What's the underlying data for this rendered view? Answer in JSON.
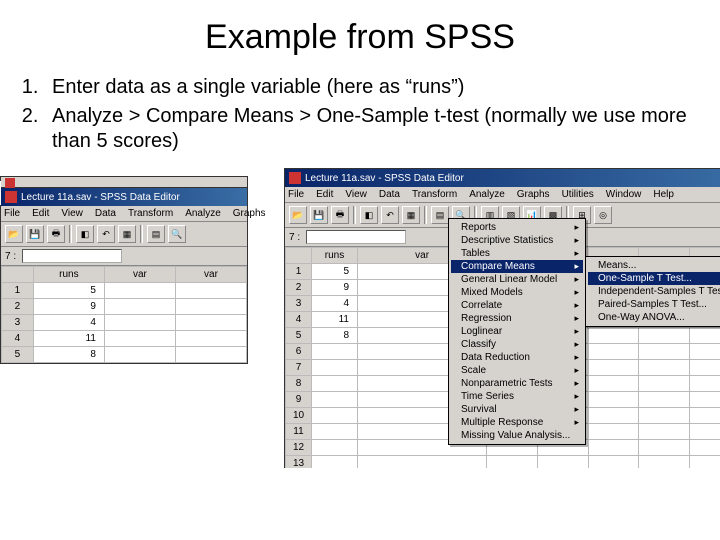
{
  "slide": {
    "title": "Example from SPSS",
    "items": [
      "Enter data as a single variable (here as “runs”)",
      "Analyze > Compare Means > One-Sample t-test (normally we use more than 5 scores)"
    ]
  },
  "left_window": {
    "title": "Lecture 11a.sav - SPSS Data Editor",
    "menus": [
      "File",
      "Edit",
      "View",
      "Data",
      "Transform",
      "Analyze",
      "Graphs"
    ],
    "cell_ref": "7 :",
    "columns": [
      "runs",
      "var",
      "var"
    ],
    "rows": [
      {
        "n": "1",
        "runs": "5"
      },
      {
        "n": "2",
        "runs": "9"
      },
      {
        "n": "3",
        "runs": "4"
      },
      {
        "n": "4",
        "runs": "11"
      },
      {
        "n": "5",
        "runs": "8"
      }
    ]
  },
  "right_window": {
    "title": "Lecture 11a.sav - SPSS Data Editor",
    "menus": [
      "File",
      "Edit",
      "View",
      "Data",
      "Transform",
      "Analyze",
      "Graphs",
      "Utilities",
      "Window",
      "Help"
    ],
    "cell_ref": "7 :",
    "columns": [
      "runs",
      "var"
    ],
    "rows": [
      {
        "n": "1",
        "runs": "5"
      },
      {
        "n": "2",
        "runs": "9"
      },
      {
        "n": "3",
        "runs": "4"
      },
      {
        "n": "4",
        "runs": "11"
      },
      {
        "n": "5",
        "runs": "8"
      },
      {
        "n": "6",
        "runs": ""
      },
      {
        "n": "7",
        "runs": ""
      },
      {
        "n": "8",
        "runs": ""
      },
      {
        "n": "9",
        "runs": ""
      },
      {
        "n": "10",
        "runs": ""
      },
      {
        "n": "11",
        "runs": ""
      },
      {
        "n": "12",
        "runs": ""
      },
      {
        "n": "13",
        "runs": ""
      }
    ]
  },
  "analyze_menu": {
    "items": [
      {
        "label": "Reports",
        "arrow": true
      },
      {
        "label": "Descriptive Statistics",
        "arrow": true
      },
      {
        "label": "Tables",
        "arrow": true
      },
      {
        "label": "Compare Means",
        "arrow": true,
        "hl": true
      },
      {
        "label": "General Linear Model",
        "arrow": true
      },
      {
        "label": "Mixed Models",
        "arrow": true
      },
      {
        "label": "Correlate",
        "arrow": true
      },
      {
        "label": "Regression",
        "arrow": true
      },
      {
        "label": "Loglinear",
        "arrow": true
      },
      {
        "label": "Classify",
        "arrow": true
      },
      {
        "label": "Data Reduction",
        "arrow": true
      },
      {
        "label": "Scale",
        "arrow": true
      },
      {
        "label": "Nonparametric Tests",
        "arrow": true
      },
      {
        "label": "Time Series",
        "arrow": true
      },
      {
        "label": "Survival",
        "arrow": true
      },
      {
        "label": "Multiple Response",
        "arrow": true
      },
      {
        "label": "Missing Value Analysis...",
        "arrow": false
      }
    ]
  },
  "compare_submenu": {
    "items": [
      {
        "label": "Means...",
        "hl": false
      },
      {
        "label": "One-Sample T Test...",
        "hl": true
      },
      {
        "label": "Independent-Samples T Test..."
      },
      {
        "label": "Paired-Samples T Test..."
      },
      {
        "label": "One-Way ANOVA..."
      }
    ]
  },
  "toolbar_icons": [
    "open",
    "save",
    "print",
    "",
    "find",
    "undo",
    "redo",
    "",
    "goto",
    "vars",
    "find2",
    "",
    "insert",
    "split",
    "weight",
    "select",
    "",
    "value",
    "sets"
  ]
}
